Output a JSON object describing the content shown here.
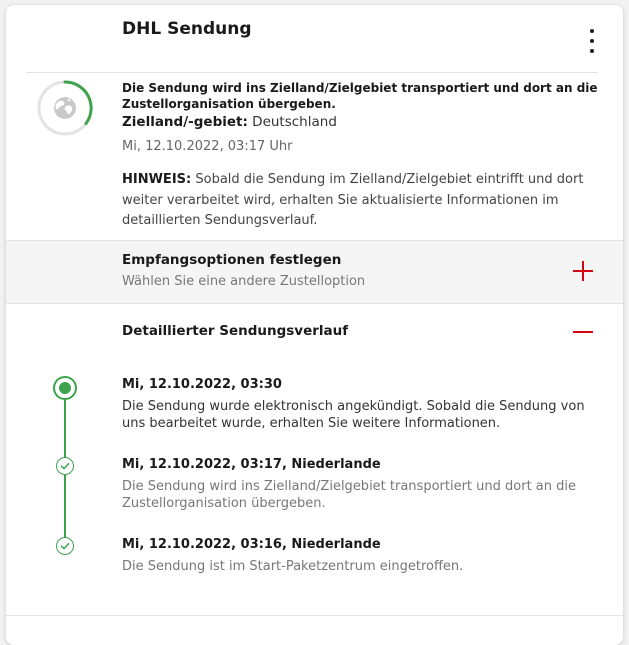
{
  "card": {
    "title": "DHL Sendung",
    "menu_icon": "kebab-menu-icon"
  },
  "status": {
    "icon": "globe-icon",
    "ring_color": "#3fa34d",
    "headline": "Die Sendung wird ins Zielland/Zielgebiet transportiert und dort an die Zustellorganisation übergeben.",
    "destination_label": "Zielland/-gebiet:",
    "destination_value": "Deutschland",
    "datetime": "Mi, 12.10.2022, 03:17 Uhr",
    "hint_label": "HINWEIS:",
    "hint_text": "Sobald die Sendung im Zielland/Zielgebiet eintrifft und dort weiter verarbeitet wird, erhalten Sie aktualisierte Informationen im detaillierten Sendungsverlauf."
  },
  "delivery_options": {
    "title": "Empfangsoptionen festlegen",
    "subtitle": "Wählen Sie eine andere Zustelloption",
    "toggle_icon": "plus-icon",
    "accent": "#d40511"
  },
  "history": {
    "title": "Detaillierter Sendungsverlauf",
    "toggle_icon": "minus-icon",
    "events": [
      {
        "title": "Mi, 12.10.2022, 03:30",
        "description": "Die Sendung wurde elektronisch angekündigt. Sobald die Sendung von uns bearbeitet wurde, erhalten Sie weitere Informationen."
      },
      {
        "title": "Mi, 12.10.2022, 03:17, Niederlande",
        "description": "Die Sendung wird ins Zielland/Zielgebiet transportiert und dort an die Zustellorganisation übergeben."
      },
      {
        "title": "Mi, 12.10.2022, 03:16, Niederlande",
        "description": "Die Sendung ist im Start-Paketzentrum eingetroffen."
      }
    ],
    "timeline_color": "#3fa34d"
  }
}
